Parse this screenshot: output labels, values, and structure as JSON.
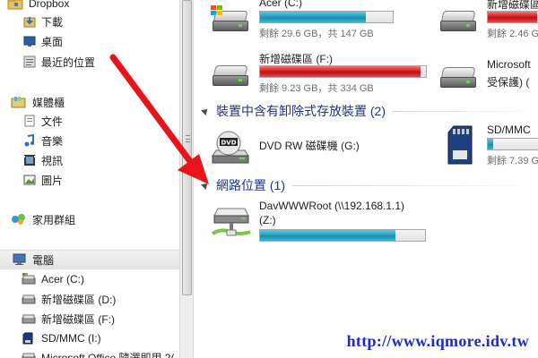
{
  "nav": {
    "favorites": [
      {
        "label": "Dropbox",
        "icon": "dropbox-folder-icon"
      },
      {
        "label": "下載",
        "icon": "downloads-icon"
      },
      {
        "label": "桌面",
        "icon": "desktop-icon"
      },
      {
        "label": "最近的位置",
        "icon": "recent-places-icon"
      }
    ],
    "libraries": {
      "label": "媒體櫃",
      "icon": "libraries-icon"
    },
    "library_items": [
      {
        "label": "文件",
        "icon": "documents-icon"
      },
      {
        "label": "音樂",
        "icon": "music-icon"
      },
      {
        "label": "視訊",
        "icon": "videos-icon"
      },
      {
        "label": "圖片",
        "icon": "pictures-icon"
      }
    ],
    "homegroup": {
      "label": "家用群組",
      "icon": "homegroup-icon"
    },
    "computer": {
      "label": "電腦",
      "icon": "computer-icon"
    },
    "computer_items": [
      {
        "label": "Acer (C:)",
        "icon": "system-drive-icon"
      },
      {
        "label": "新增磁碟區 (D:)",
        "icon": "drive-icon"
      },
      {
        "label": "新增磁碟區 (F:)",
        "icon": "drive-icon"
      },
      {
        "label": "SD/MMC (I:)",
        "icon": "sd-card-icon"
      },
      {
        "label": "Microsoft Office 隨選即用 2(",
        "icon": "drive-icon"
      }
    ]
  },
  "content": {
    "hard_drives": [
      {
        "name": "Acer (C:)",
        "free": "剩餘 29.6 GB，共 147 GB",
        "used_fraction": 0.8,
        "status": "normal"
      },
      {
        "name": "新增磁碟區 (F:)",
        "free": "剩餘 9.23 GB，共 334 GB",
        "used_fraction": 0.97,
        "status": "full"
      }
    ],
    "hard_drives_right": [
      {
        "name": "新增磁碟區",
        "free": "剩餘 2.46 G",
        "used_fraction": 0.95,
        "status": "full"
      },
      {
        "name": "Microsoft",
        "sub": "受保護) (",
        "status": "none"
      }
    ],
    "removable_group": {
      "label": "裝置中含有卸除式存放裝置 (2)"
    },
    "removable": [
      {
        "name": "DVD RW 磁碟機 (G:)",
        "icon": "dvd-drive-icon"
      },
      {
        "name": "SD/MMC",
        "free": "剩餘 7.39 G",
        "used_fraction": 0.1,
        "icon": "sd-card-icon"
      }
    ],
    "network_group": {
      "label": "網路位置 (1)"
    },
    "network": [
      {
        "name": "DavWWWRoot (\\\\192.168.1.1)",
        "sub": "(Z:)",
        "used_fraction": 0.82,
        "icon": "network-drive-icon"
      }
    ]
  },
  "watermark": "http://www.iqmore.idv.tw",
  "colors": {
    "bar_normal": "#26a0c3",
    "bar_full": "#d51e1e",
    "group_header": "#1e3287",
    "arrow": "#e8141a",
    "watermark": "#1c2ac8"
  }
}
